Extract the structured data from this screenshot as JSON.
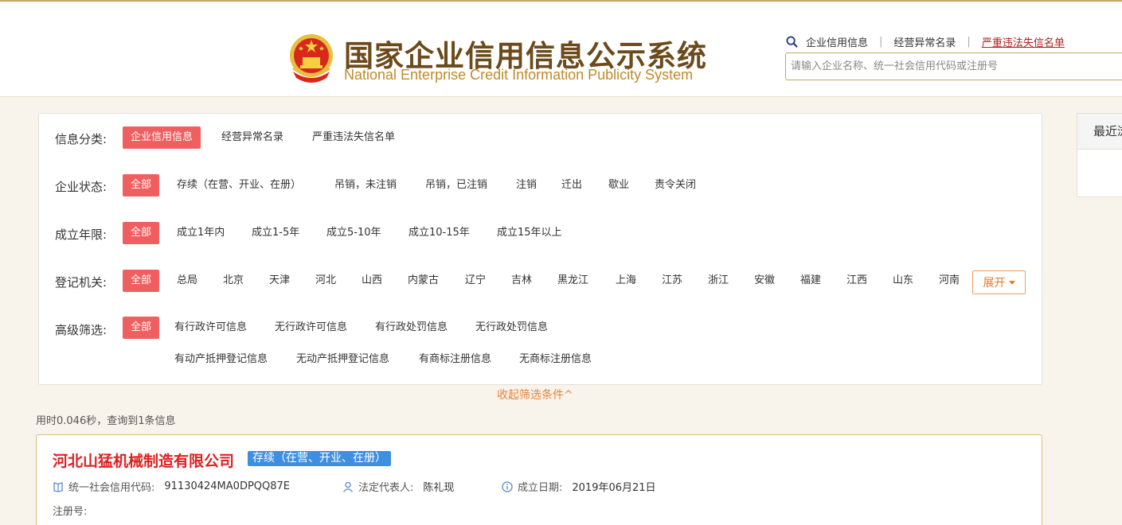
{
  "header": {
    "title_cn": "国家企业信用信息公示系统",
    "title_en": "National Enterprise Credit Information Publicity System",
    "links": [
      "企业信用信息",
      "经营异常名录",
      "严重违法失信名单"
    ],
    "search_placeholder": "请输入企业名称、统一社会信用代码或注册号"
  },
  "filters": {
    "category": {
      "label": "信息分类:",
      "options": [
        "企业信用信息",
        "经营异常名录",
        "严重违法失信名单"
      ]
    },
    "status": {
      "label": "企业状态:",
      "options": [
        "全部",
        "存续（在营、开业、在册）",
        "吊销，未注销",
        "吊销，已注销",
        "注销",
        "迁出",
        "歇业",
        "责令关闭"
      ]
    },
    "years": {
      "label": "成立年限:",
      "options": [
        "全部",
        "成立1年内",
        "成立1-5年",
        "成立5-10年",
        "成立10-15年",
        "成立15年以上"
      ]
    },
    "authority": {
      "label": "登记机关:",
      "options": [
        "全部",
        "总局",
        "北京",
        "天津",
        "河北",
        "山西",
        "内蒙古",
        "辽宁",
        "吉林",
        "黑龙江",
        "上海",
        "江苏",
        "浙江",
        "安徽",
        "福建",
        "江西",
        "山东",
        "河南"
      ],
      "expand_label": "展开"
    },
    "advanced": {
      "label": "高级筛选:",
      "options": [
        "全部",
        "有行政许可信息",
        "无行政许可信息",
        "有行政处罚信息",
        "无行政处罚信息",
        "有动产抵押登记信息",
        "无动产抵押登记信息",
        "有商标注册信息",
        "无商标注册信息"
      ]
    }
  },
  "collapse_label": "收起筛选条件^",
  "result_stats": "用时0.046秒，查询到1条信息",
  "result": {
    "company_name": "河北山猛机械制造有限公司",
    "status": "存续（在营、开业、在册）",
    "credit_code_label": "统一社会信用代码:",
    "credit_code": "91130424MA0DPQQ87E",
    "legal_rep_label": "法定代表人:",
    "legal_rep": "陈礼现",
    "founded_label": "成立日期:",
    "founded": "2019年06月21日",
    "reg_label": "注册号:"
  },
  "side": {
    "title": "最近浏览"
  },
  "colors": {
    "accent_red": "#ef5f5f",
    "badge_blue": "#3f8fe0",
    "gold": "#c7a564",
    "orange": "#e4853a"
  }
}
